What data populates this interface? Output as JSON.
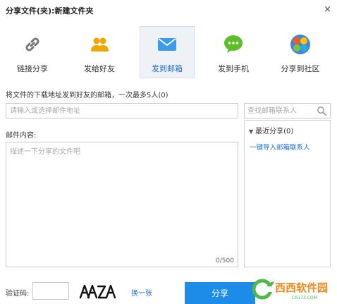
{
  "dialog": {
    "title": "分享文件(夹):新建文件夹",
    "close_glyph": "×"
  },
  "tabs": [
    {
      "label": "链接分享",
      "icon": "link-icon",
      "active": false
    },
    {
      "label": "发给好友",
      "icon": "friends-icon",
      "active": false
    },
    {
      "label": "发到邮箱",
      "icon": "mail-icon",
      "active": true
    },
    {
      "label": "发到手机",
      "icon": "chat-phone-icon",
      "active": false
    },
    {
      "label": "分享到社区",
      "icon": "community-icon",
      "active": false
    }
  ],
  "email": {
    "hint": "将文件的下载地址发到好友的邮箱，一次最多5人(0)",
    "placeholder": "请输入或选择邮件地址"
  },
  "contacts": {
    "search_placeholder": "查找邮箱联系人",
    "recent_label": "最近分享(0)",
    "import_link": "一键导入邮箱联系人"
  },
  "content": {
    "label": "邮件内容:",
    "placeholder": "描述一下分享的文件吧",
    "counter": "0/500"
  },
  "captcha": {
    "label": "验证码:",
    "image_text": "AAZA",
    "refresh_link": "换一张"
  },
  "share_button": "分享",
  "watermark": {
    "brand": "西西软件园",
    "domain": "CR173.COM"
  },
  "colors": {
    "accent": "#1c8ce8",
    "link": "#1a6fd1",
    "active_tab_bg": "#eef1f5"
  }
}
